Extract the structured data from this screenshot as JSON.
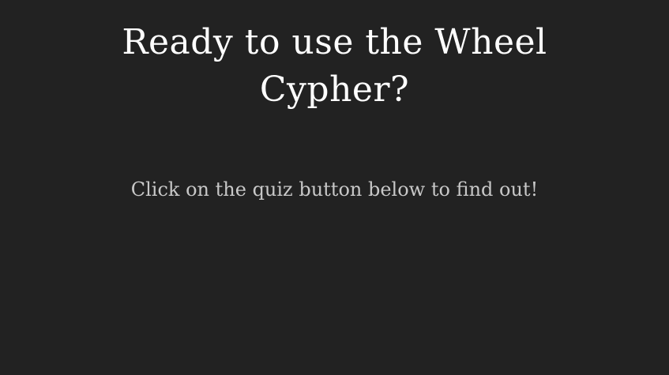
{
  "slide": {
    "title": "Ready to use the Wheel Cypher?",
    "subtitle": "Click on the quiz button below to find out!"
  },
  "colors": {
    "background": "#222222",
    "title": "#ffffff",
    "subtitle": "#c8c8c8"
  }
}
